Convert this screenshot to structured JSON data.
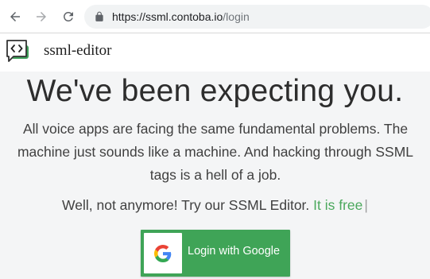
{
  "browser": {
    "url_host": "https://ssml.contoba.io",
    "url_path": "/login"
  },
  "header": {
    "app_name": "ssml-editor"
  },
  "main": {
    "headline": "We've been expecting you.",
    "subtext": "All voice apps are facing the same fundamental problems. The machine just sounds like a machine. And hacking through SSML tags is a hell of a job.",
    "tagline_prefix": "Well, not anymore! Try our SSML Editor. ",
    "tagline_free": "It is free",
    "cursor": "|",
    "login_button_label": "Login with Google"
  },
  "colors": {
    "button_green": "#3fa457",
    "accent_green": "#4aa85c",
    "logo_green": "#3ea05a"
  }
}
